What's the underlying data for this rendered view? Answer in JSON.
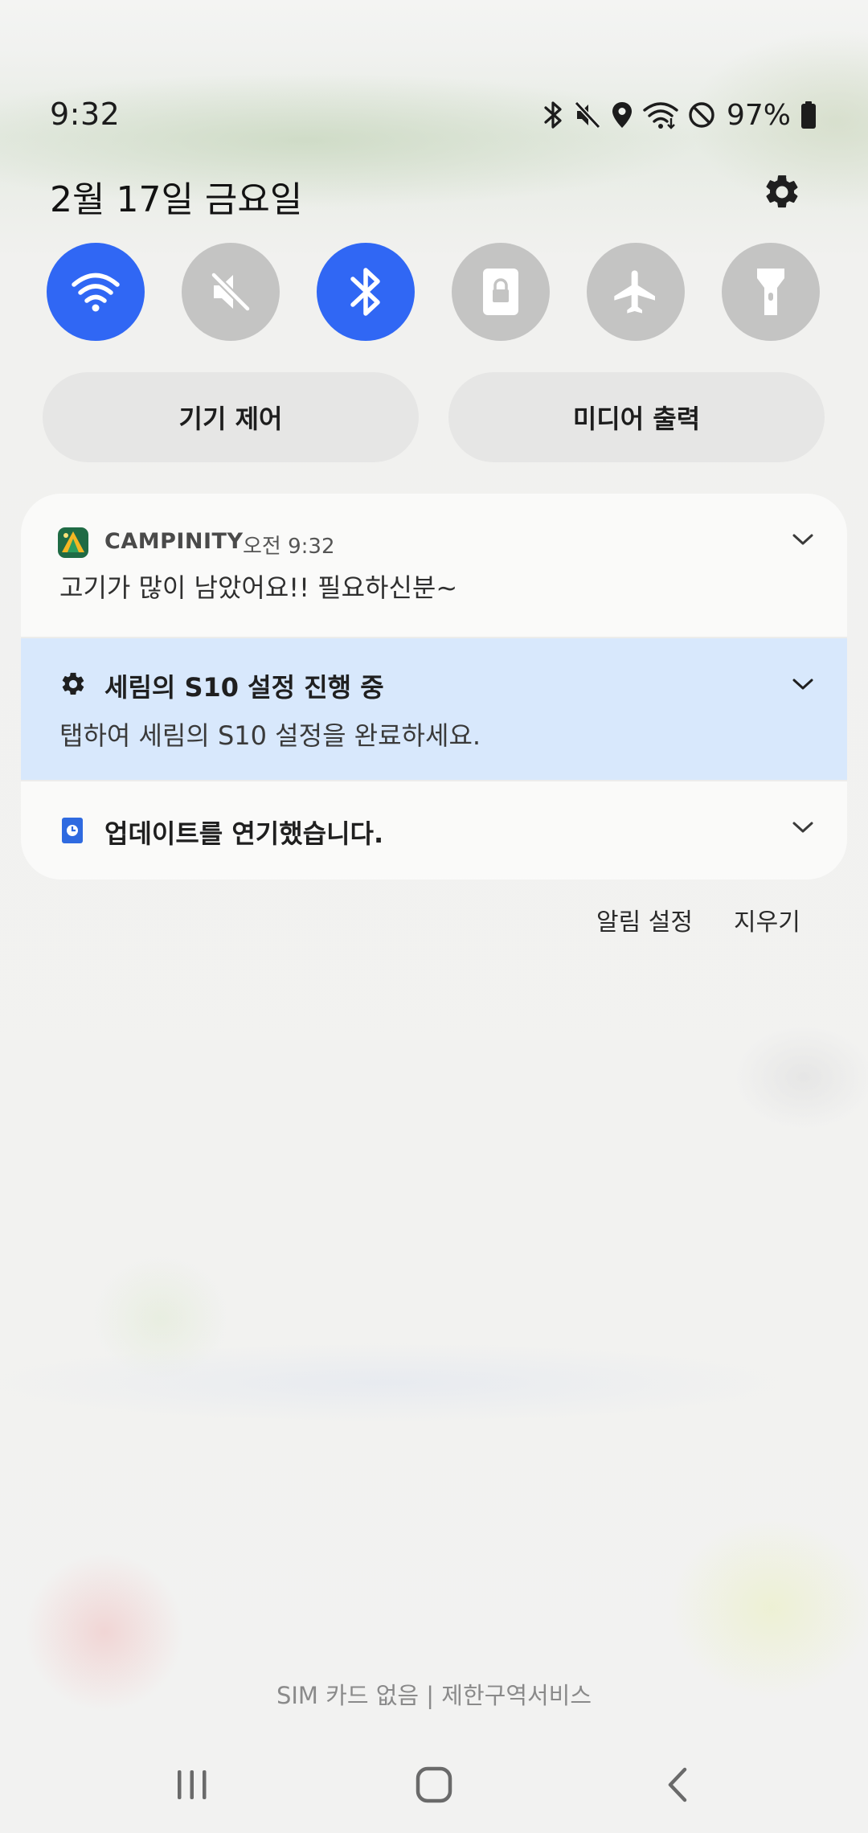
{
  "status_bar": {
    "time": "9:32",
    "battery_percent": "97%",
    "icons": [
      "bluetooth-icon",
      "mute-icon",
      "location-icon",
      "wifi-icon",
      "do-not-disturb-icon",
      "battery-icon"
    ]
  },
  "header": {
    "date": "2월 17일 금요일",
    "settings_icon": "gear-icon"
  },
  "quick_settings": {
    "tiles": [
      {
        "name": "wifi",
        "icon": "wifi-icon",
        "active": true
      },
      {
        "name": "sound",
        "icon": "mute-icon",
        "active": false
      },
      {
        "name": "bluetooth",
        "icon": "bluetooth-icon",
        "active": true
      },
      {
        "name": "rotation-lock",
        "icon": "portrait-lock-icon",
        "active": false
      },
      {
        "name": "airplane-mode",
        "icon": "airplane-icon",
        "active": false
      },
      {
        "name": "flashlight",
        "icon": "flashlight-icon",
        "active": false
      }
    ],
    "active_color": "#3067f4",
    "inactive_color": "#c4c4c3",
    "device_control_label": "기기 제어",
    "media_output_label": "미디어 출력"
  },
  "notifications": [
    {
      "app_name": "CAMPINITY",
      "time": "오전 9:32",
      "body": "고기가 많이 남았어요!! 필요하신분~"
    },
    {
      "title": "세림의 S10 설정 진행 중",
      "body": "탭하여 세림의 S10 설정을 완료하세요.",
      "background": "#d8e8fc"
    },
    {
      "title": "업데이트를 연기했습니다."
    }
  ],
  "actions": {
    "notification_settings": "알림 설정",
    "clear": "지우기"
  },
  "carrier_text": "SIM 카드 없음 | 제한구역서비스",
  "nav_bar": {
    "recents_icon": "recents-icon",
    "home_icon": "home-icon",
    "back_icon": "back-icon"
  }
}
